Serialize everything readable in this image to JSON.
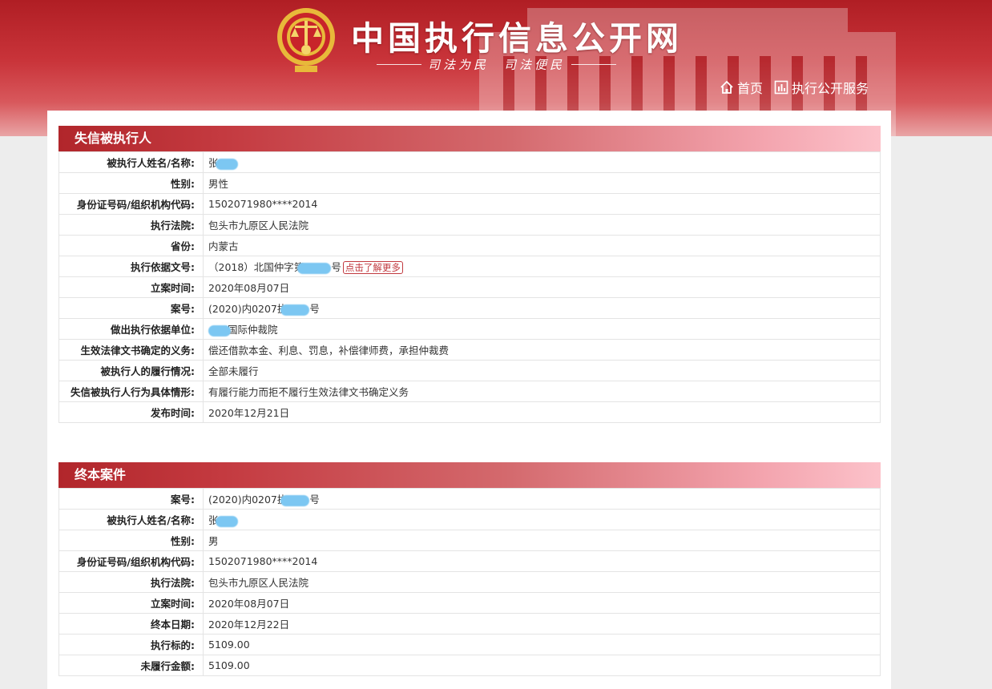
{
  "header": {
    "site_title": "中国执行信息公开网",
    "slogan": "司法为民　司法便民",
    "nav": [
      {
        "label": "首页",
        "icon": "home-icon"
      },
      {
        "label": "执行公开服务",
        "icon": "chart-icon"
      }
    ],
    "colors": {
      "brand_red": "#b01e24",
      "header_gradient_end": "#fcc2ca"
    }
  },
  "dishonest": {
    "title": "失信被执行人",
    "rows": [
      {
        "label": "被执行人姓名/名称:",
        "value": "张"
      },
      {
        "label": "性别:",
        "value": "男性"
      },
      {
        "label": "身份证号码/组织机构代码:",
        "value": "1502071980****2014"
      },
      {
        "label": "执行法院:",
        "value": "包头市九原区人民法院"
      },
      {
        "label": "省份:",
        "value": "内蒙古"
      },
      {
        "label": "执行依据文号:",
        "value_prefix": "（2018）北国仲字第",
        "value_suffix": "号",
        "link": "点击了解更多"
      },
      {
        "label": "立案时间:",
        "value": "2020年08月07日"
      },
      {
        "label": "案号:",
        "value_prefix": "(2020)内0207执",
        "value_suffix": "号"
      },
      {
        "label": "做出执行依据单位:",
        "value": "国际仲裁院"
      },
      {
        "label": "生效法律文书确定的义务:",
        "value": "偿还借款本金、利息、罚息，补偿律师费，承担仲裁费"
      },
      {
        "label": "被执行人的履行情况:",
        "value": "全部未履行"
      },
      {
        "label": "失信被执行人行为具体情形:",
        "value": "有履行能力而拒不履行生效法律文书确定义务"
      },
      {
        "label": "发布时间:",
        "value": "2020年12月21日"
      }
    ]
  },
  "terminated": {
    "title": "终本案件",
    "rows": [
      {
        "label": "案号:",
        "value_prefix": "(2020)内0207执",
        "value_suffix": "号"
      },
      {
        "label": "被执行人姓名/名称:",
        "value": "张"
      },
      {
        "label": "性别:",
        "value": "男"
      },
      {
        "label": "身份证号码/组织机构代码:",
        "value": "1502071980****2014"
      },
      {
        "label": "执行法院:",
        "value": "包头市九原区人民法院"
      },
      {
        "label": "立案时间:",
        "value": "2020年08月07日"
      },
      {
        "label": "终本日期:",
        "value": "2020年12月22日"
      },
      {
        "label": "执行标的:",
        "value": "5109.00"
      },
      {
        "label": "未履行金额:",
        "value": "5109.00"
      }
    ]
  }
}
